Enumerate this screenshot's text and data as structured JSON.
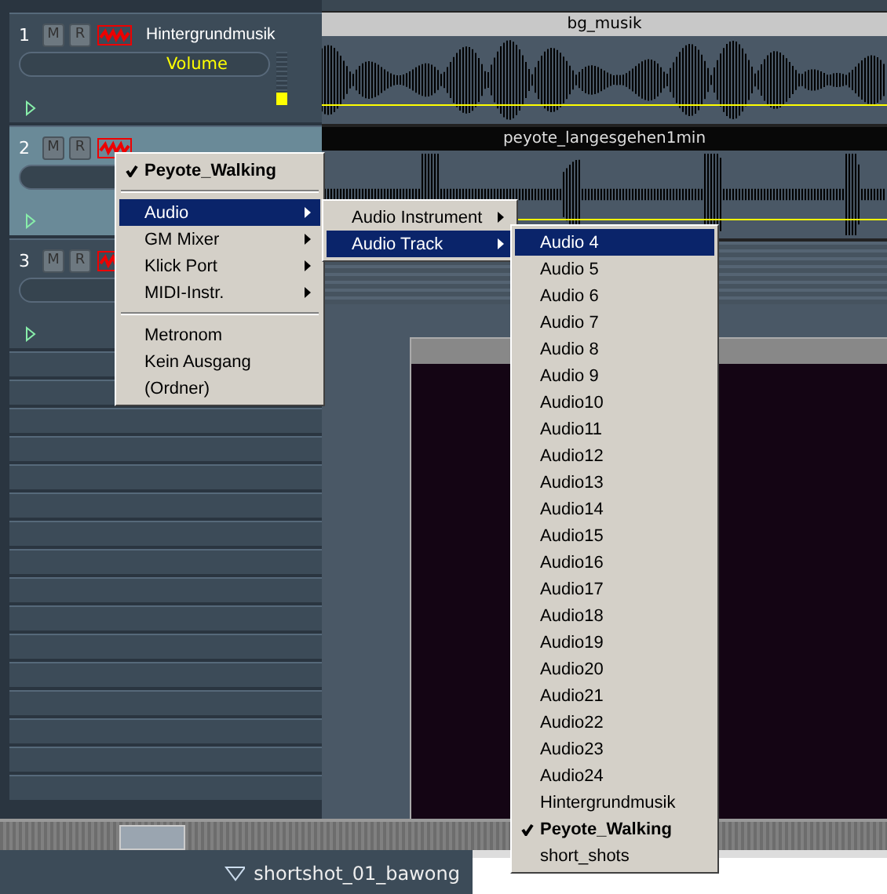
{
  "tracks": [
    {
      "number": "1",
      "name": "Hintergrundmusik",
      "selected": false,
      "field": "Volume",
      "level": 0.25,
      "mute": "M",
      "record": "R"
    },
    {
      "number": "2",
      "selected": true,
      "mute": "M",
      "record": "R"
    },
    {
      "number": "3",
      "selected": false,
      "mute": "M",
      "record": "R"
    }
  ],
  "clips": [
    {
      "name": "bg_musik",
      "kind": "light"
    },
    {
      "name": "peyote_langesgehen1min",
      "kind": "dark"
    }
  ],
  "context_menu": {
    "items": [
      {
        "label": "Peyote_Walking",
        "kind": "item",
        "checked": true,
        "selected": false,
        "submenu": false
      },
      {
        "kind": "separator"
      },
      {
        "label": "Audio",
        "kind": "item",
        "checked": false,
        "selected": true,
        "submenu": true
      },
      {
        "label": "GM Mixer",
        "kind": "item",
        "checked": false,
        "selected": false,
        "submenu": true
      },
      {
        "label": "Klick Port",
        "kind": "item",
        "checked": false,
        "selected": false,
        "submenu": true
      },
      {
        "label": "MIDI-Instr.",
        "kind": "item",
        "checked": false,
        "selected": false,
        "submenu": true
      },
      {
        "kind": "separator"
      },
      {
        "label": "Metronom",
        "kind": "item",
        "checked": false,
        "selected": false,
        "submenu": false
      },
      {
        "label": "Kein Ausgang",
        "kind": "item",
        "checked": false,
        "selected": false,
        "submenu": false
      },
      {
        "label": "(Ordner)",
        "kind": "item",
        "checked": false,
        "selected": false,
        "submenu": false
      }
    ]
  },
  "audio_submenu": {
    "items": [
      {
        "label": "Audio Instrument",
        "selected": false,
        "submenu": true
      },
      {
        "label": "Audio Track",
        "selected": true,
        "submenu": true
      }
    ]
  },
  "track_submenu": {
    "items": [
      {
        "label": "Audio 4",
        "selected": true,
        "checked": false
      },
      {
        "label": "Audio 5",
        "selected": false,
        "checked": false
      },
      {
        "label": "Audio 6",
        "selected": false,
        "checked": false
      },
      {
        "label": "Audio 7",
        "selected": false,
        "checked": false
      },
      {
        "label": "Audio 8",
        "selected": false,
        "checked": false
      },
      {
        "label": "Audio 9",
        "selected": false,
        "checked": false
      },
      {
        "label": "Audio10",
        "selected": false,
        "checked": false
      },
      {
        "label": "Audio11",
        "selected": false,
        "checked": false
      },
      {
        "label": "Audio12",
        "selected": false,
        "checked": false
      },
      {
        "label": "Audio13",
        "selected": false,
        "checked": false
      },
      {
        "label": "Audio14",
        "selected": false,
        "checked": false
      },
      {
        "label": "Audio15",
        "selected": false,
        "checked": false
      },
      {
        "label": "Audio16",
        "selected": false,
        "checked": false
      },
      {
        "label": "Audio17",
        "selected": false,
        "checked": false
      },
      {
        "label": "Audio18",
        "selected": false,
        "checked": false
      },
      {
        "label": "Audio19",
        "selected": false,
        "checked": false
      },
      {
        "label": "Audio20",
        "selected": false,
        "checked": false
      },
      {
        "label": "Audio21",
        "selected": false,
        "checked": false
      },
      {
        "label": "Audio22",
        "selected": false,
        "checked": false
      },
      {
        "label": "Audio23",
        "selected": false,
        "checked": false
      },
      {
        "label": "Audio24",
        "selected": false,
        "checked": false
      },
      {
        "label": "Hintergrundmusik",
        "selected": false,
        "checked": false
      },
      {
        "label": "Peyote_Walking",
        "selected": false,
        "checked": true
      },
      {
        "label": "short_shots",
        "selected": false,
        "checked": false
      }
    ]
  },
  "bottom_panel": {
    "folder_name": "shortshot_01_bawong"
  }
}
